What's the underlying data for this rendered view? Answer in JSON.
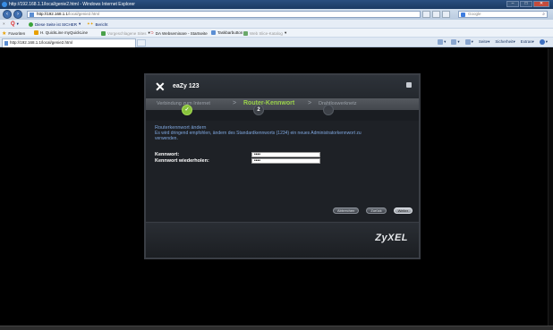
{
  "browser": {
    "title": "http://192.168.1.1/local/genie2.html - Windows Internet Explorer",
    "url_host": "http://192.168.1.1",
    "url_rest": "/local/genie2.html",
    "search_placeholder": "Google",
    "window_buttons": {
      "minimize": "–",
      "maximize": "□",
      "close": "✕"
    }
  },
  "toolbar": {
    "status_label": "Diese Seite ist SICHER",
    "report_label": "Bericht"
  },
  "favorites": {
    "label": "Favoriten",
    "items": [
      "H. QuickLine myQuickLine",
      "Vorgeschlagene Sites",
      "DA Webseminare - Startseite",
      "Taskbarbutton",
      "Web Slice-Katalog"
    ]
  },
  "tab": {
    "title": "http://192.168.1.1/local/genie2.html"
  },
  "commands": {
    "page": "Seite",
    "safety": "Sicherheit",
    "extras": "Extras",
    "help": "?"
  },
  "dialog": {
    "logo": "eaZy 123",
    "steps": [
      "Verbindung zum Internet",
      "Router-Kennwort",
      "Drahtloswerknetz"
    ],
    "step_separator": ">",
    "step_numbers": [
      "✓",
      "2",
      "3"
    ],
    "heading": "Routerkennwort ändern",
    "description": "Es wird dringend empfohlen, ändern des Standardkennworts (1234) ein neues Administratorkennwort zu verwenden.",
    "fields": [
      {
        "label": "Kennwort:",
        "value": "••••"
      },
      {
        "label": "Kennwort wiederholen:",
        "value": "••••"
      }
    ],
    "buttons": [
      "Abbrechen",
      "Zurück",
      "Weiter"
    ],
    "brand": "ZyXEL"
  }
}
